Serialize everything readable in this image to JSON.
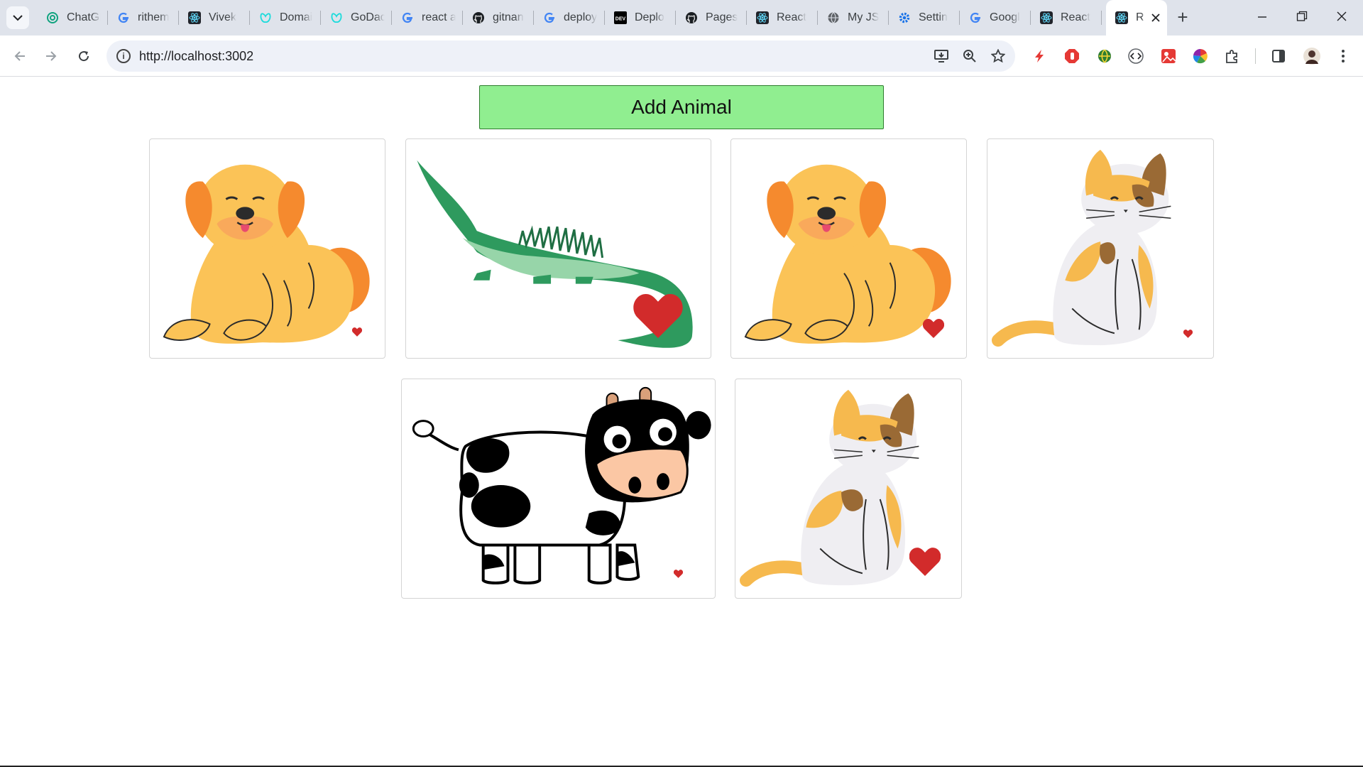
{
  "browser": {
    "tabs": [
      {
        "label": "ChatGPT",
        "icon": "openai-icon"
      },
      {
        "label": "rithem",
        "icon": "google-icon"
      },
      {
        "label": "Vivek",
        "icon": "react-icon"
      },
      {
        "label": "Domai",
        "icon": "godaddy-icon"
      },
      {
        "label": "GoDad",
        "icon": "godaddy-icon"
      },
      {
        "label": "react a",
        "icon": "google-icon"
      },
      {
        "label": "gitnan",
        "icon": "github-icon"
      },
      {
        "label": "deploy",
        "icon": "google-icon"
      },
      {
        "label": "Deplo",
        "icon": "dev-icon"
      },
      {
        "label": "Pages",
        "icon": "github-icon"
      },
      {
        "label": "React",
        "icon": "react-icon"
      },
      {
        "label": "My JS",
        "icon": "globe-icon"
      },
      {
        "label": "Settin",
        "icon": "gear-icon"
      },
      {
        "label": "Googl",
        "icon": "google-icon"
      },
      {
        "label": "React",
        "icon": "react-icon"
      }
    ],
    "active_tab": {
      "label": "R",
      "icon": "react-icon"
    },
    "new_tab_label": "+",
    "url": "http://localhost:3002"
  },
  "page": {
    "add_button_label": "Add Animal",
    "animals": [
      {
        "type": "dog",
        "heart_size": "small"
      },
      {
        "type": "gator",
        "heart_size": "large"
      },
      {
        "type": "dog",
        "heart_size": "medium"
      },
      {
        "type": "cat",
        "heart_size": "small"
      },
      {
        "type": "cow",
        "heart_size": "small"
      },
      {
        "type": "cat",
        "heart_size": "large"
      }
    ]
  },
  "colors": {
    "add_button": "#90ee90",
    "heart": "#d22b2b",
    "dog_body": "#fbc357",
    "dog_ear": "#f58a2e",
    "gator": "#2e9a5e",
    "gator_light": "#97d5a9"
  }
}
